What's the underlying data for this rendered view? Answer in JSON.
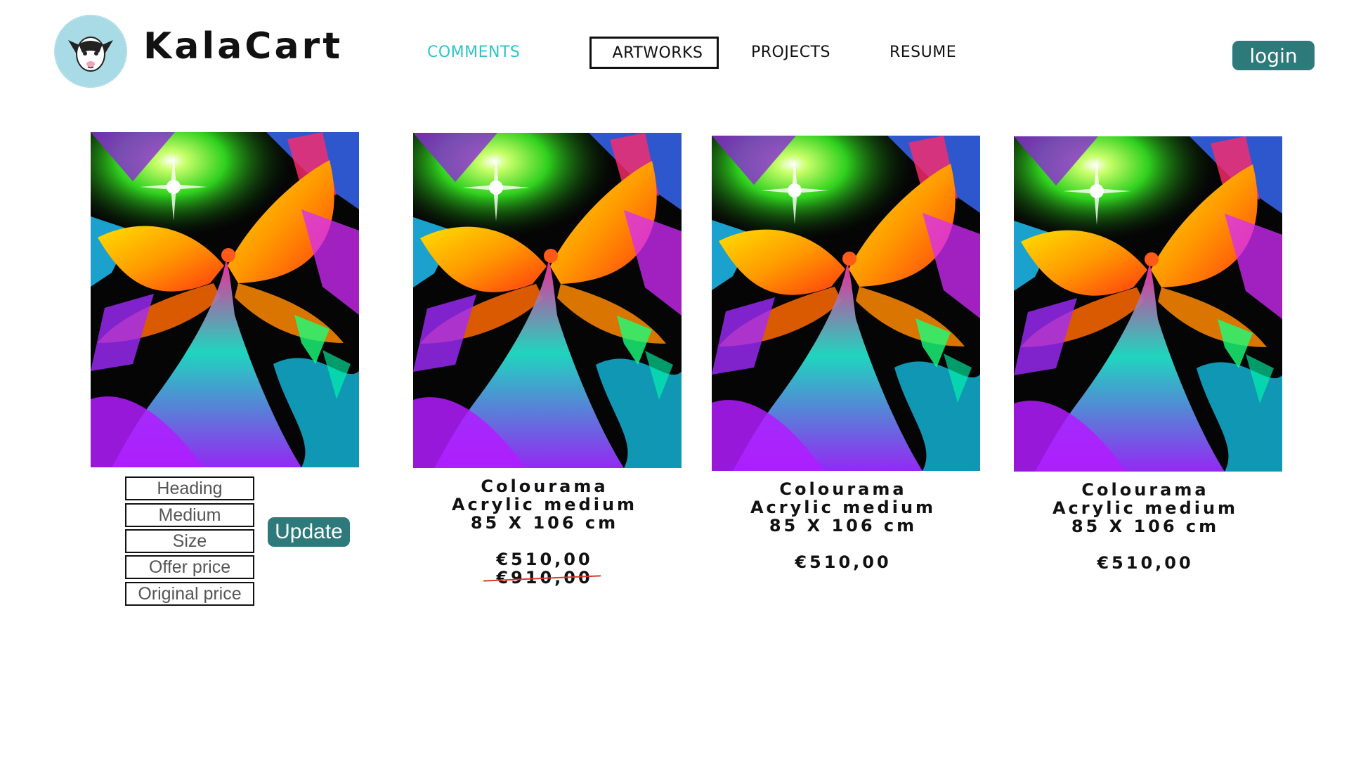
{
  "header": {
    "brand": "KalaCart",
    "logo_icon": "goat-logo-icon",
    "nav": {
      "comments": "COMMENTS",
      "artworks": "ARTWORKS",
      "projects": "PROJECTS",
      "resume": "RESUME"
    },
    "active_nav": "ARTWORKS",
    "login_label": "login"
  },
  "colors": {
    "accent": "#2e7a7b",
    "nav_active_text": "#2ec4c9",
    "strike": "#d83a2c",
    "logo_bg": "#a9dbe6"
  },
  "editor": {
    "fields": {
      "heading": "Heading",
      "medium": "Medium",
      "size": "Size",
      "offer_price": "Offer price",
      "original_price": "Original price"
    },
    "update_label": "Update"
  },
  "products": [
    {
      "title": "Colourama",
      "medium": "Acrylic medium",
      "size": "85 X 106 cm",
      "price": "€510,00",
      "original_price": "€910,00"
    },
    {
      "title": "Colourama",
      "medium": "Acrylic medium",
      "size": "85 X 106 cm",
      "price": "€510,00"
    },
    {
      "title": "Colourama",
      "medium": "Acrylic medium",
      "size": "85 X 106 cm",
      "price": "€510,00"
    }
  ]
}
